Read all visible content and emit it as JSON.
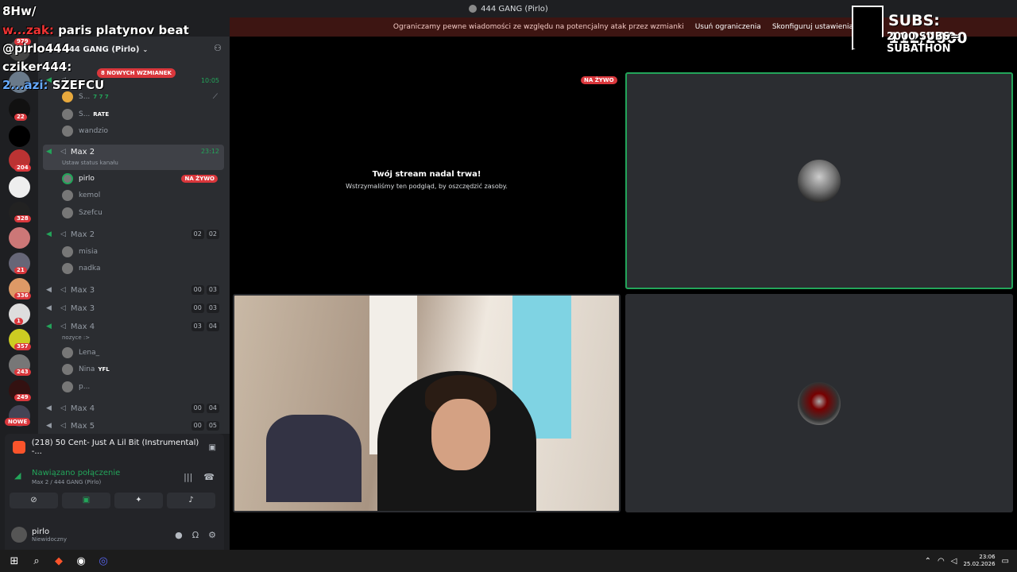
{
  "window": {
    "title": "444 GANG (Pirlo)"
  },
  "notice": {
    "text": "Ograniczamy pewne wiadomości ze względu na potencjalny atak przez wzmianki",
    "btn1": "Usuń ograniczenia",
    "btn2": "Skonfiguruj ustawienia"
  },
  "guild_badges": [
    "979",
    "22",
    "204",
    "328",
    "21",
    "336",
    "1",
    "357",
    "243",
    "249"
  ],
  "guild_new": "NOWE",
  "server": {
    "name": "444 GANG (Pirlo)",
    "chevron": "⌄",
    "mentions": "8 NOWYCH WZMIANEK"
  },
  "channels": {
    "c1": {
      "time": "10:05"
    },
    "c1_users": [
      {
        "name": "S...",
        "tag": "7 7 7"
      },
      {
        "name": "S...",
        "tag": "RATE"
      },
      {
        "name": "wandzio"
      }
    ],
    "c2": {
      "name": "Max 2",
      "time": "23:12",
      "status": "Ustaw status kanału"
    },
    "c2_users": [
      {
        "name": "pirlo",
        "live": "NA ŻYWO"
      },
      {
        "name": "kemol"
      },
      {
        "name": "Szefcu"
      }
    ],
    "c3": {
      "name": "Max 2",
      "a": "02",
      "b": "02"
    },
    "c3_users": [
      {
        "name": "misia"
      },
      {
        "name": "nadka"
      }
    ],
    "c4": {
      "name": "Max 3",
      "a": "00",
      "b": "03"
    },
    "c5": {
      "name": "Max 3",
      "a": "00",
      "b": "03"
    },
    "c6": {
      "name": "Max 4",
      "a": "03",
      "b": "04",
      "status": "nozyce :>"
    },
    "c6_users": [
      {
        "name": "Lena_"
      },
      {
        "name": "Nina",
        "tag": "YFL"
      },
      {
        "name": "p..."
      }
    ],
    "c7": {
      "name": "Max 4",
      "a": "00",
      "b": "04"
    },
    "c8": {
      "name": "Max 5",
      "a": "00",
      "b": "05"
    }
  },
  "activity": {
    "title": "(218) 50 Cent- Just A Lil Bit (Instrumental) -..."
  },
  "voice": {
    "title": "Nawiązano połączenie",
    "sub": "Max 2 / 444 GANG (Pirlo)"
  },
  "user": {
    "name": "pirlo",
    "status": "Niewidoczny"
  },
  "stage": {
    "paused_title": "Twój stream nadal trwa!",
    "paused_desc": "Wstrzymaliśmy ten podgląd, by oszczędzić zasoby.",
    "live": "NA ŻYWO"
  },
  "overlay": {
    "l1": "8Hw/",
    "l2_user": "w...zak:",
    "l2_msg": "paris platynov beat",
    "l3": "@pirlo444",
    "l4": "cziker444:",
    "l5_user": "2...azi:",
    "l5_msg": "SZEFCU"
  },
  "subs": {
    "line1": "SUBS: 112/2000",
    "line2": "2000 SUBS= SUBATHON"
  },
  "clock": {
    "time": "23:06",
    "date": "25.02.2026"
  },
  "colors": {
    "accent_green": "#23a55a",
    "alert_red": "#da373c",
    "bg_dark": "#1e1f22",
    "sidebar": "#2b2d31"
  }
}
